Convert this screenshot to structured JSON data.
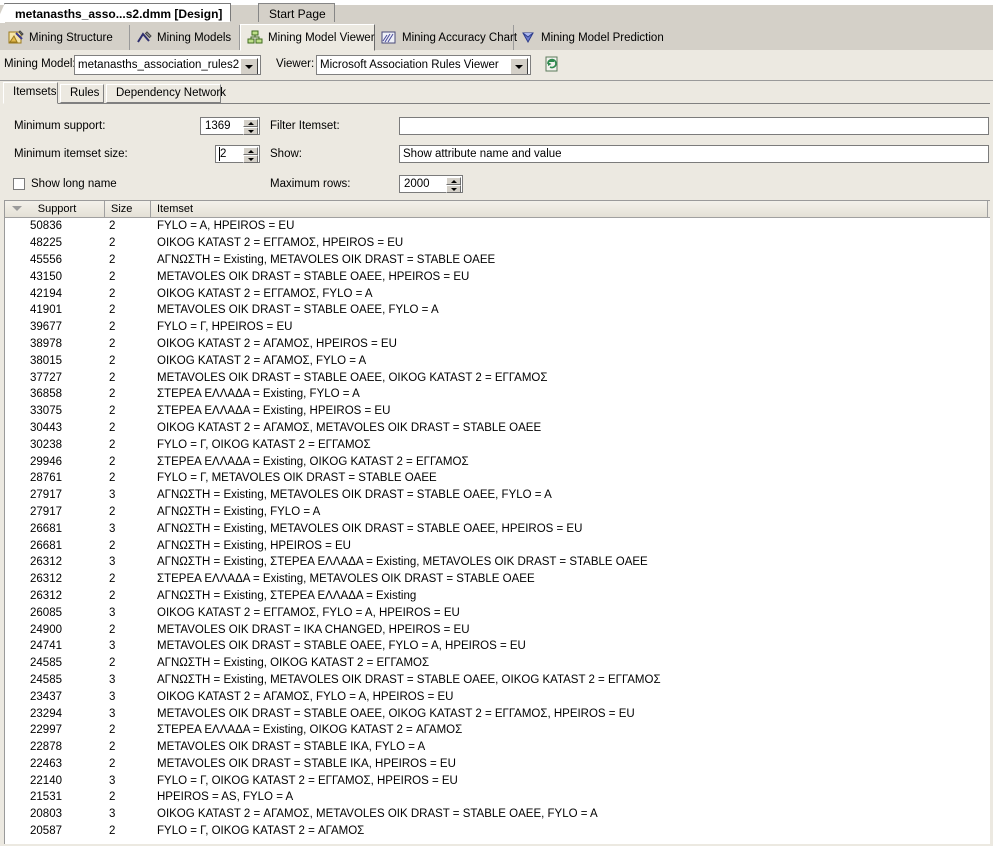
{
  "window": {
    "document_tabs": [
      {
        "label": "metanasths_asso...s2.dmm [Design]",
        "active": true
      },
      {
        "label": "Start Page",
        "active": false
      }
    ]
  },
  "designer_tabs": [
    {
      "label": "Mining Structure",
      "icon": "mining-structure-icon",
      "selected": false
    },
    {
      "label": "Mining Models",
      "icon": "mining-models-icon",
      "selected": false
    },
    {
      "label": "Mining Model Viewer",
      "icon": "mining-model-viewer-icon",
      "selected": true
    },
    {
      "label": "Mining Accuracy Chart",
      "icon": "mining-accuracy-chart-icon",
      "selected": false
    },
    {
      "label": "Mining Model Prediction",
      "icon": "mining-model-prediction-icon",
      "selected": false
    }
  ],
  "model_bar": {
    "mining_model_label": "Mining Model:",
    "mining_model_value": "metanasths_association_rules2",
    "viewer_label": "Viewer:",
    "viewer_value": "Microsoft Association Rules Viewer",
    "refresh_icon": "refresh-icon"
  },
  "viewer_tabs": [
    {
      "label": "Itemsets",
      "selected": true
    },
    {
      "label": "Rules",
      "selected": false
    },
    {
      "label": "Dependency Network",
      "selected": false
    }
  ],
  "controls": {
    "minimum_support_label": "Minimum support:",
    "minimum_support_value": "1369",
    "minimum_itemset_size_label": "Minimum itemset size:",
    "minimum_itemset_size_value": "2",
    "show_long_name_label": "Show long name",
    "show_long_name_checked": false,
    "filter_itemset_label": "Filter Itemset:",
    "filter_itemset_value": "",
    "filter_itemset_placeholder": "",
    "show_label": "Show:",
    "show_value": "Show attribute name and value",
    "maximum_rows_label": "Maximum rows:",
    "maximum_rows_value": "2000"
  },
  "grid": {
    "columns": [
      "Support",
      "Size",
      "Itemset"
    ],
    "sort_column": "Support",
    "sort_direction": "descending",
    "rows": [
      {
        "support": "50836",
        "size": "2",
        "itemset": "FYLO = A, HPEIROS = EU"
      },
      {
        "support": "48225",
        "size": "2",
        "itemset": "OIKOG KATAST 2 = ΕΓΓΑΜΟΣ, HPEIROS = EU"
      },
      {
        "support": "45556",
        "size": "2",
        "itemset": "ΑΓΝΩΣΤΗ = Existing, METAVOLES OIK DRAST = STABLE OAEE"
      },
      {
        "support": "43150",
        "size": "2",
        "itemset": "METAVOLES OIK DRAST = STABLE OAEE, HPEIROS = EU"
      },
      {
        "support": "42194",
        "size": "2",
        "itemset": "OIKOG KATAST 2 = ΕΓΓΑΜΟΣ, FYLO = A"
      },
      {
        "support": "41901",
        "size": "2",
        "itemset": "METAVOLES OIK DRAST = STABLE OAEE, FYLO = A"
      },
      {
        "support": "39677",
        "size": "2",
        "itemset": "FYLO = Γ, HPEIROS = EU"
      },
      {
        "support": "38978",
        "size": "2",
        "itemset": "OIKOG KATAST 2 = ΑΓΑΜΟΣ, HPEIROS = EU"
      },
      {
        "support": "38015",
        "size": "2",
        "itemset": "OIKOG KATAST 2 = ΑΓΑΜΟΣ, FYLO = A"
      },
      {
        "support": "37727",
        "size": "2",
        "itemset": "METAVOLES OIK DRAST = STABLE OAEE, OIKOG KATAST 2 = ΕΓΓΑΜΟΣ"
      },
      {
        "support": "36858",
        "size": "2",
        "itemset": "ΣΤΕΡΕΑ ΕΛΛΑΔΑ = Existing, FYLO = A"
      },
      {
        "support": "33075",
        "size": "2",
        "itemset": "ΣΤΕΡΕΑ ΕΛΛΑΔΑ = Existing, HPEIROS = EU"
      },
      {
        "support": "30443",
        "size": "2",
        "itemset": "OIKOG KATAST 2 = ΑΓΑΜΟΣ, METAVOLES OIK DRAST = STABLE OAEE"
      },
      {
        "support": "30238",
        "size": "2",
        "itemset": "FYLO = Γ, OIKOG KATAST 2 = ΕΓΓΑΜΟΣ"
      },
      {
        "support": "29946",
        "size": "2",
        "itemset": "ΣΤΕΡΕΑ ΕΛΛΑΔΑ = Existing, OIKOG KATAST 2 = ΕΓΓΑΜΟΣ"
      },
      {
        "support": "28761",
        "size": "2",
        "itemset": "FYLO = Γ, METAVOLES OIK DRAST = STABLE OAEE"
      },
      {
        "support": "27917",
        "size": "3",
        "itemset": "ΑΓΝΩΣΤΗ = Existing, METAVOLES OIK DRAST = STABLE OAEE, FYLO = A"
      },
      {
        "support": "27917",
        "size": "2",
        "itemset": "ΑΓΝΩΣΤΗ = Existing, FYLO = A"
      },
      {
        "support": "26681",
        "size": "3",
        "itemset": "ΑΓΝΩΣΤΗ = Existing, METAVOLES OIK DRAST = STABLE OAEE, HPEIROS = EU"
      },
      {
        "support": "26681",
        "size": "2",
        "itemset": "ΑΓΝΩΣΤΗ = Existing, HPEIROS = EU"
      },
      {
        "support": "26312",
        "size": "3",
        "itemset": "ΑΓΝΩΣΤΗ = Existing, ΣΤΕΡΕΑ ΕΛΛΑΔΑ = Existing, METAVOLES OIK DRAST = STABLE OAEE"
      },
      {
        "support": "26312",
        "size": "2",
        "itemset": "ΣΤΕΡΕΑ ΕΛΛΑΔΑ = Existing, METAVOLES OIK DRAST = STABLE OAEE"
      },
      {
        "support": "26312",
        "size": "2",
        "itemset": "ΑΓΝΩΣΤΗ = Existing, ΣΤΕΡΕΑ ΕΛΛΑΔΑ = Existing"
      },
      {
        "support": "26085",
        "size": "3",
        "itemset": "OIKOG KATAST 2 = ΕΓΓΑΜΟΣ, FYLO = A, HPEIROS = EU"
      },
      {
        "support": "24900",
        "size": "2",
        "itemset": "METAVOLES OIK DRAST = IKA CHANGED, HPEIROS = EU"
      },
      {
        "support": "24741",
        "size": "3",
        "itemset": "METAVOLES OIK DRAST = STABLE OAEE, FYLO = A, HPEIROS = EU"
      },
      {
        "support": "24585",
        "size": "2",
        "itemset": "ΑΓΝΩΣΤΗ = Existing, OIKOG KATAST 2 = ΕΓΓΑΜΟΣ"
      },
      {
        "support": "24585",
        "size": "3",
        "itemset": "ΑΓΝΩΣΤΗ = Existing, METAVOLES OIK DRAST = STABLE OAEE, OIKOG KATAST 2 = ΕΓΓΑΜΟΣ"
      },
      {
        "support": "23437",
        "size": "3",
        "itemset": "OIKOG KATAST 2 = ΑΓΑΜΟΣ, FYLO = A, HPEIROS = EU"
      },
      {
        "support": "23294",
        "size": "3",
        "itemset": "METAVOLES OIK DRAST = STABLE OAEE, OIKOG KATAST 2 = ΕΓΓΑΜΟΣ, HPEIROS = EU"
      },
      {
        "support": "22997",
        "size": "2",
        "itemset": "ΣΤΕΡΕΑ ΕΛΛΑΔΑ = Existing, OIKOG KATAST 2 = ΑΓΑΜΟΣ"
      },
      {
        "support": "22878",
        "size": "2",
        "itemset": "METAVOLES OIK DRAST = STABLE IKA, FYLO = A"
      },
      {
        "support": "22463",
        "size": "2",
        "itemset": "METAVOLES OIK DRAST = STABLE IKA, HPEIROS = EU"
      },
      {
        "support": "22140",
        "size": "3",
        "itemset": "FYLO = Γ, OIKOG KATAST 2 = ΕΓΓΑΜΟΣ, HPEIROS = EU"
      },
      {
        "support": "21531",
        "size": "2",
        "itemset": "HPEIROS = AS, FYLO = A"
      },
      {
        "support": "20803",
        "size": "3",
        "itemset": "OIKOG KATAST 2 = ΑΓΑΜΟΣ, METAVOLES OIK DRAST = STABLE OAEE, FYLO = A"
      },
      {
        "support": "20587",
        "size": "2",
        "itemset": "FYLO = Γ, OIKOG KATAST 2 = ΑΓΑΜΟΣ"
      }
    ]
  },
  "colors": {
    "chrome": "#d4d0c8",
    "panel": "#ece9e1",
    "border": "#808080",
    "grid_background": "#ffffff"
  }
}
